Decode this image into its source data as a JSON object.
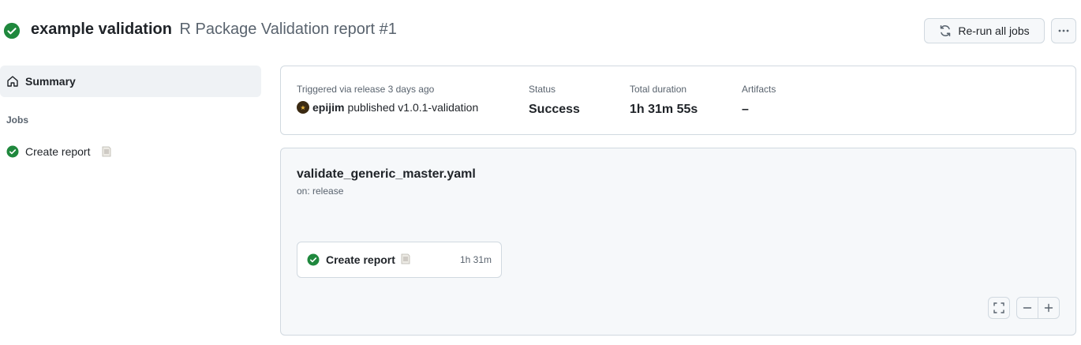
{
  "header": {
    "workflow_name": "example validation",
    "run_title": "R Package Validation report #1",
    "rerun_label": "Re-run all jobs",
    "status_icon": "check-circle-fill-icon",
    "colors": {
      "success": "#1f883d",
      "muted": "#59636e"
    }
  },
  "sidebar": {
    "summary_label": "Summary",
    "jobs_heading": "Jobs",
    "jobs": [
      {
        "label": "Create report",
        "emoji": "📃",
        "status": "success"
      }
    ]
  },
  "summary": {
    "trigger_label": "Triggered via release 3 days ago",
    "actor": "epijim",
    "action_text": "published v1.0.1-validation",
    "status_label": "Status",
    "status_value": "Success",
    "duration_label": "Total duration",
    "duration_value": "1h 31m 55s",
    "artifacts_label": "Artifacts",
    "artifacts_value": "–"
  },
  "graph": {
    "workflow_file": "validate_generic_master.yaml",
    "trigger": "on: release",
    "job_name": "Create report",
    "job_duration": "1h 31m"
  }
}
